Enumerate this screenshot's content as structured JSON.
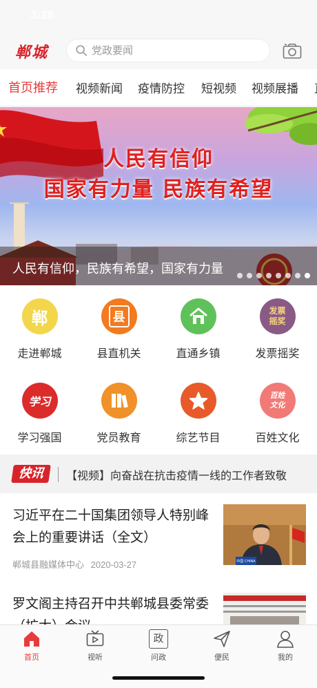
{
  "status_bar": {
    "time": "3:28"
  },
  "header": {
    "logo": "郸城",
    "search_placeholder": "党政要闻",
    "search_icon": "search-icon",
    "camera_icon": "camera-icon"
  },
  "tabs": [
    {
      "label": "首页推荐",
      "active": true
    },
    {
      "label": "视频新闻"
    },
    {
      "label": "疫情防控"
    },
    {
      "label": "短视频"
    },
    {
      "label": "视频展播"
    },
    {
      "label": "直"
    }
  ],
  "banner": {
    "headline_line1": "人民有信仰",
    "headline_line2": "国家有力量  民族有希望",
    "caption": "人民有信仰，民族有希望，国家有力量",
    "slide_count": 8,
    "active_slide": 7
  },
  "grid": [
    {
      "label": "走进郸城",
      "icon_text": "郸",
      "color": "#f2d64b",
      "text_color": "#ffffff",
      "icon": "city-emblem-icon"
    },
    {
      "label": "县直机关",
      "icon_text": "县",
      "color": "#f47a1f",
      "text_color": "#ffffff",
      "icon": "government-badge-icon"
    },
    {
      "label": "直通乡镇",
      "icon_text": "",
      "color": "#5fc15a",
      "text_color": "#ffffff",
      "icon": "house-icon"
    },
    {
      "label": "发票摇奖",
      "icon_text": "发票摇奖",
      "color": "#8a5a86",
      "text_color": "#f6d57b",
      "icon": "invoice-lottery-icon"
    },
    {
      "label": "学习强国",
      "icon_text": "学习",
      "color": "#dc2b2b",
      "text_color": "#ffffff",
      "icon": "study-icon"
    },
    {
      "label": "党员教育",
      "icon_text": "",
      "color": "#f0912a",
      "text_color": "#ffffff",
      "icon": "books-icon"
    },
    {
      "label": "综艺节目",
      "icon_text": "",
      "color": "#e85a2a",
      "text_color": "#ffffff",
      "icon": "star-icon"
    },
    {
      "label": "百姓文化",
      "icon_text": "百姓文化",
      "color": "#f17a76",
      "text_color": "#ffffff",
      "icon": "culture-icon"
    }
  ],
  "flash": {
    "badge": "快讯",
    "text": "【视频】向奋战在抗击疫情一线的工作者致敬"
  },
  "news": [
    {
      "title": "习近平在二十国集团领导人特别峰会上的重要讲话（全文）",
      "source": "郸城县融媒体中心",
      "date": "2020-03-27",
      "thumb_caption": "中国 CHINA"
    },
    {
      "title": "罗文阁主持召开中共郸城县委常委（扩大）会议",
      "source": "",
      "date": ""
    }
  ],
  "bottom_nav": [
    {
      "label": "首页",
      "icon": "home-icon",
      "active": true
    },
    {
      "label": "视听",
      "icon": "tv-icon"
    },
    {
      "label": "问政",
      "icon": "politics-icon",
      "icon_text": "政"
    },
    {
      "label": "便民",
      "icon": "send-icon"
    },
    {
      "label": "我的",
      "icon": "user-icon"
    }
  ],
  "colors": {
    "accent": "#e63c3c",
    "logo_red": "#d8232a"
  }
}
